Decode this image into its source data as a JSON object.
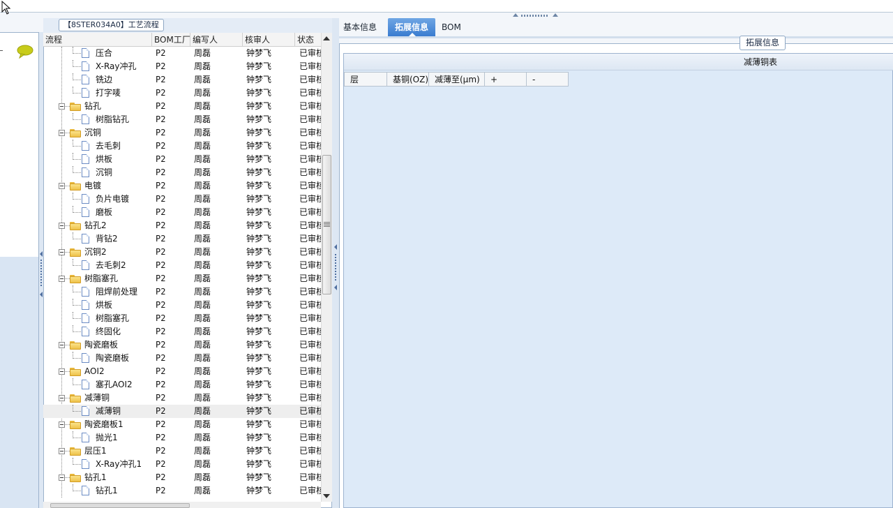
{
  "process_panel": {
    "title": "【8STER034A0】工艺流程",
    "columns": [
      "流程",
      "BOM工厂",
      "编写人",
      "核审人",
      "状态"
    ],
    "rows": [
      {
        "level": 2,
        "label": "压合",
        "bom": "P2",
        "author": "周磊",
        "reviewer": "钟梦飞",
        "status": "已审核"
      },
      {
        "level": 2,
        "label": "X-Ray冲孔",
        "bom": "P2",
        "author": "周磊",
        "reviewer": "钟梦飞",
        "status": "已审核"
      },
      {
        "level": 2,
        "label": "铣边",
        "bom": "P2",
        "author": "周磊",
        "reviewer": "钟梦飞",
        "status": "已审核"
      },
      {
        "level": 2,
        "label": "打字唛",
        "bom": "P2",
        "author": "周磊",
        "reviewer": "钟梦飞",
        "status": "已审核"
      },
      {
        "level": 1,
        "label": "钻孔",
        "bom": "P2",
        "author": "周磊",
        "reviewer": "钟梦飞",
        "status": "已审核"
      },
      {
        "level": 2,
        "label": "树脂钻孔",
        "bom": "P2",
        "author": "周磊",
        "reviewer": "钟梦飞",
        "status": "已审核"
      },
      {
        "level": 1,
        "label": "沉铜",
        "bom": "P2",
        "author": "周磊",
        "reviewer": "钟梦飞",
        "status": "已审核"
      },
      {
        "level": 2,
        "label": "去毛刺",
        "bom": "P2",
        "author": "周磊",
        "reviewer": "钟梦飞",
        "status": "已审核"
      },
      {
        "level": 2,
        "label": "烘板",
        "bom": "P2",
        "author": "周磊",
        "reviewer": "钟梦飞",
        "status": "已审核"
      },
      {
        "level": 2,
        "label": "沉铜",
        "bom": "P2",
        "author": "周磊",
        "reviewer": "钟梦飞",
        "status": "已审核"
      },
      {
        "level": 1,
        "label": "电镀",
        "bom": "P2",
        "author": "周磊",
        "reviewer": "钟梦飞",
        "status": "已审核"
      },
      {
        "level": 2,
        "label": "负片电镀",
        "bom": "P2",
        "author": "周磊",
        "reviewer": "钟梦飞",
        "status": "已审核"
      },
      {
        "level": 2,
        "label": "磨板",
        "bom": "P2",
        "author": "周磊",
        "reviewer": "钟梦飞",
        "status": "已审核"
      },
      {
        "level": 1,
        "label": "钻孔2",
        "bom": "P2",
        "author": "周磊",
        "reviewer": "钟梦飞",
        "status": "已审核"
      },
      {
        "level": 2,
        "label": "背钻2",
        "bom": "P2",
        "author": "周磊",
        "reviewer": "钟梦飞",
        "status": "已审核"
      },
      {
        "level": 1,
        "label": "沉铜2",
        "bom": "P2",
        "author": "周磊",
        "reviewer": "钟梦飞",
        "status": "已审核"
      },
      {
        "level": 2,
        "label": "去毛刺2",
        "bom": "P2",
        "author": "周磊",
        "reviewer": "钟梦飞",
        "status": "已审核"
      },
      {
        "level": 1,
        "label": "树脂塞孔",
        "bom": "P2",
        "author": "周磊",
        "reviewer": "钟梦飞",
        "status": "已审核"
      },
      {
        "level": 2,
        "label": "阻焊前处理",
        "bom": "P2",
        "author": "周磊",
        "reviewer": "钟梦飞",
        "status": "已审核"
      },
      {
        "level": 2,
        "label": "烘板",
        "bom": "P2",
        "author": "周磊",
        "reviewer": "钟梦飞",
        "status": "已审核"
      },
      {
        "level": 2,
        "label": "树脂塞孔",
        "bom": "P2",
        "author": "周磊",
        "reviewer": "钟梦飞",
        "status": "已审核"
      },
      {
        "level": 2,
        "label": "终固化",
        "bom": "P2",
        "author": "周磊",
        "reviewer": "钟梦飞",
        "status": "已审核"
      },
      {
        "level": 1,
        "label": "陶瓷磨板",
        "bom": "P2",
        "author": "周磊",
        "reviewer": "钟梦飞",
        "status": "已审核"
      },
      {
        "level": 2,
        "label": "陶瓷磨板",
        "bom": "P2",
        "author": "周磊",
        "reviewer": "钟梦飞",
        "status": "已审核"
      },
      {
        "level": 1,
        "label": "AOI2",
        "bom": "P2",
        "author": "周磊",
        "reviewer": "钟梦飞",
        "status": "已审核"
      },
      {
        "level": 2,
        "label": "塞孔AOI2",
        "bom": "P2",
        "author": "周磊",
        "reviewer": "钟梦飞",
        "status": "已审核"
      },
      {
        "level": 1,
        "label": "减薄铜",
        "bom": "P2",
        "author": "周磊",
        "reviewer": "钟梦飞",
        "status": "已审核"
      },
      {
        "level": 2,
        "label": "减薄铜",
        "bom": "P2",
        "author": "周磊",
        "reviewer": "钟梦飞",
        "status": "已审核",
        "selected": true
      },
      {
        "level": 1,
        "label": "陶瓷磨板1",
        "bom": "P2",
        "author": "周磊",
        "reviewer": "钟梦飞",
        "status": "已审核"
      },
      {
        "level": 2,
        "label": "抛光1",
        "bom": "P2",
        "author": "周磊",
        "reviewer": "钟梦飞",
        "status": "已审核"
      },
      {
        "level": 1,
        "label": "层压1",
        "bom": "P2",
        "author": "周磊",
        "reviewer": "钟梦飞",
        "status": "已审核"
      },
      {
        "level": 2,
        "label": "X-Ray冲孔1",
        "bom": "P2",
        "author": "周磊",
        "reviewer": "钟梦飞",
        "status": "已审核"
      },
      {
        "level": 1,
        "label": "钻孔1",
        "bom": "P2",
        "author": "周磊",
        "reviewer": "钟梦飞",
        "status": "已审核"
      },
      {
        "level": 2,
        "label": "钻孔1",
        "bom": "P2",
        "author": "周磊",
        "reviewer": "钟梦飞",
        "status": "已审核"
      }
    ]
  },
  "tabs": [
    {
      "label": "基本信息",
      "active": false
    },
    {
      "label": "拓展信息",
      "active": true
    },
    {
      "label": "BOM",
      "active": false
    }
  ],
  "extended": {
    "legend": "拓展信息",
    "table_title": "减薄铜表",
    "columns": [
      "层",
      "基铜(OZ)",
      "减薄至(μm)",
      "+",
      "-"
    ]
  },
  "colors": {
    "tab_active": "#3a7cd0",
    "folder": "#eec24a",
    "panel_bg": "#ddeaf8"
  },
  "icons": {
    "chat": "speech-bubble-icon",
    "folder": "folder-icon",
    "doc": "document-icon"
  }
}
